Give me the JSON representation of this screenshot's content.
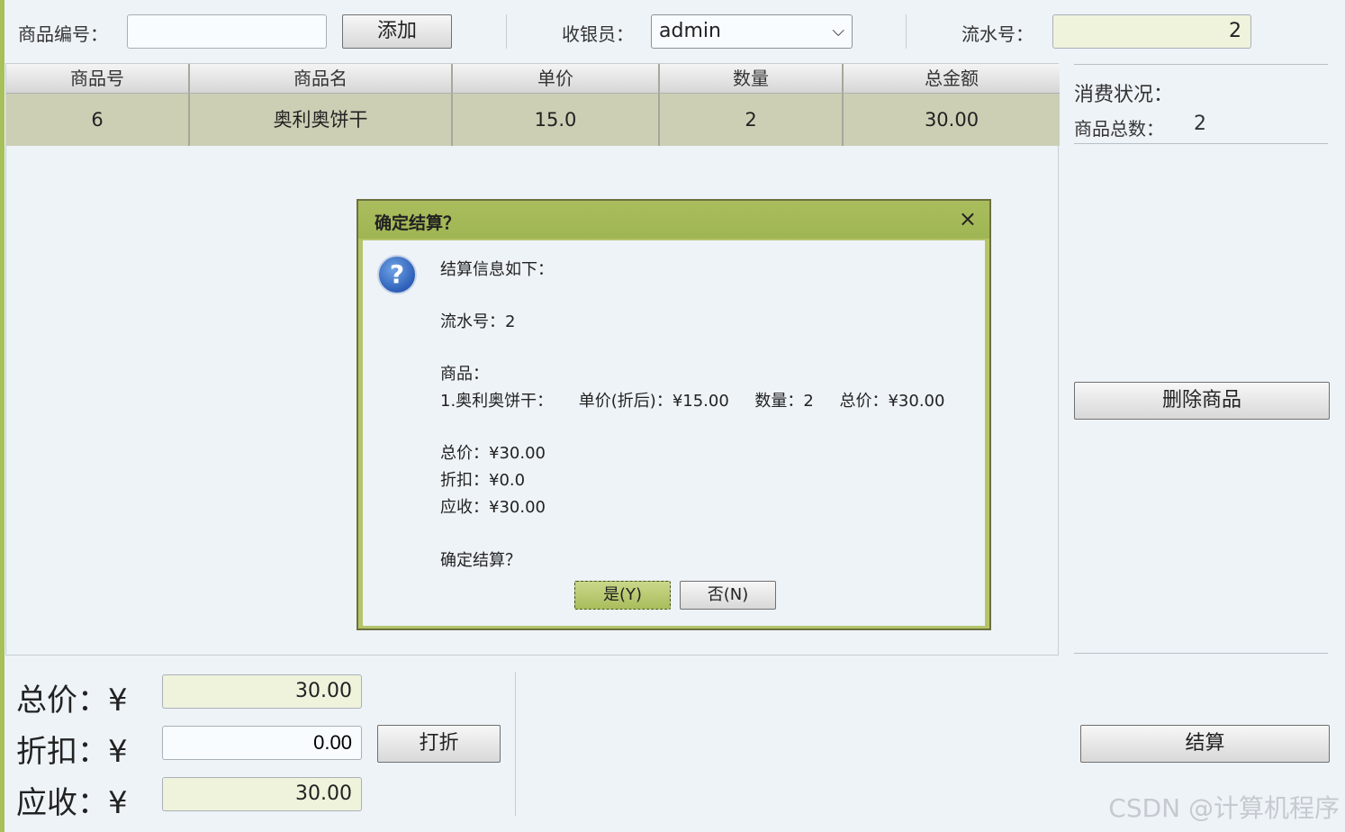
{
  "toolbar": {
    "product_code_label": "商品编号：",
    "product_code_value": "",
    "add_label": "添加",
    "cashier_label": "收银员：",
    "cashier_value": "admin",
    "serial_label": "流水号：",
    "serial_value": "2"
  },
  "table": {
    "headers": [
      "商品号",
      "商品名",
      "单价",
      "数量",
      "总金额"
    ],
    "rows": [
      [
        "6",
        "奥利奥饼干",
        "15.0",
        "2",
        "30.00"
      ]
    ]
  },
  "side": {
    "status_label": "消费状况：",
    "count_label": "商品总数：",
    "count_value": "2",
    "delete_label": "删除商品",
    "checkout_label": "结算"
  },
  "dialog": {
    "title": "确定结算？",
    "close": "×",
    "intro": "结算信息如下：",
    "serial": "流水号：2",
    "goods_label": "商品：",
    "goods_line": "1.奥利奥饼干：     单价(折后)：¥15.00     数量：2     总价：¥30.00",
    "total": "总价：¥30.00",
    "discount": "折扣：¥0.0",
    "due": "应收：¥30.00",
    "confirm": "确定结算？",
    "yes": "是(Y)",
    "no": "否(N)"
  },
  "bottom": {
    "total_label": "总价：¥",
    "total_value": "30.00",
    "discount_label": "折扣：¥",
    "discount_value": "0.00",
    "discount_button": "打折",
    "due_label": "应收：¥",
    "due_value": "30.00"
  },
  "watermark": "CSDN @计算机程序",
  "colors": {
    "accent": "#a8c05a",
    "row_bg": "#cdcfb5",
    "field_green": "#f0f3dc"
  }
}
